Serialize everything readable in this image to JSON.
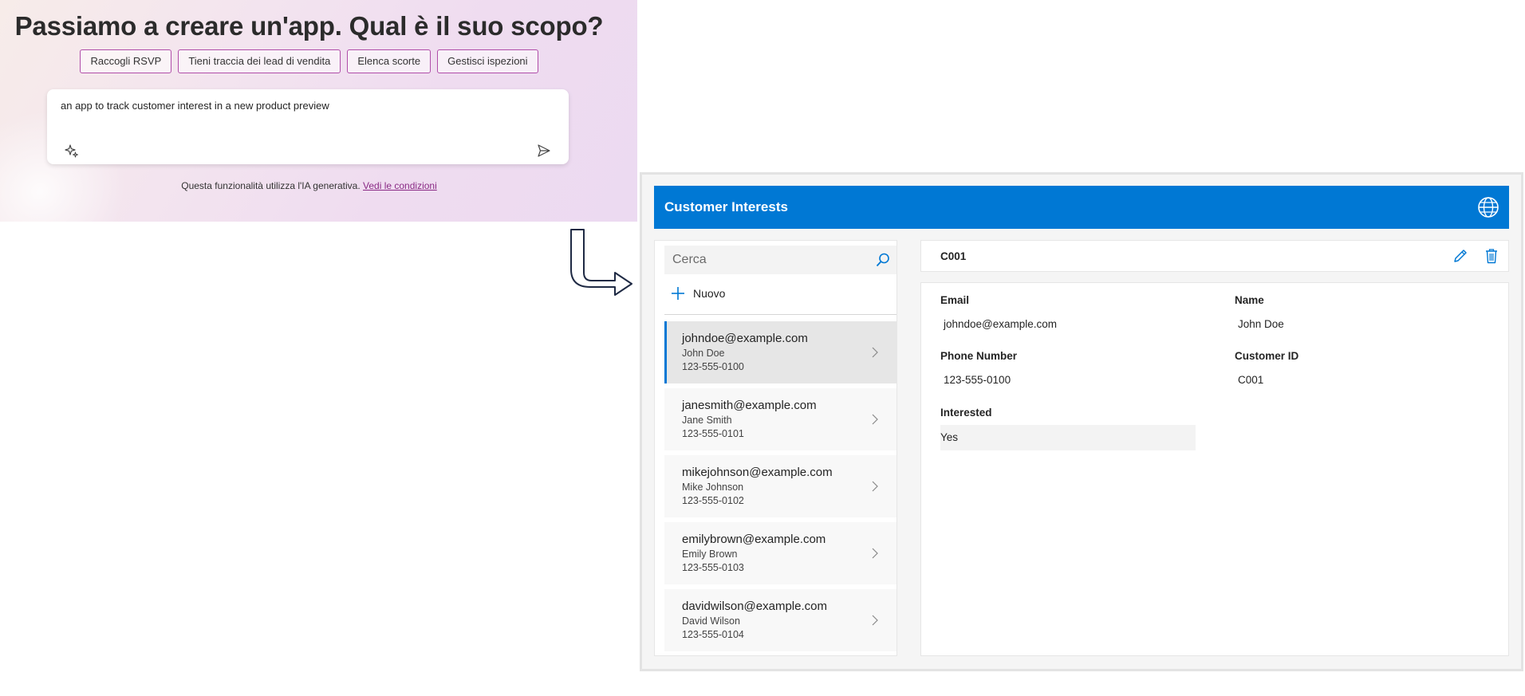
{
  "prompt": {
    "title": "Passiamo a creare un'app. Qual è il suo scopo?",
    "chips": [
      "Raccogli RSVP",
      "Tieni traccia dei lead di vendita",
      "Elenca scorte",
      "Gestisci ispezioni"
    ],
    "input_value": "an app to track customer interest in a new product preview",
    "disclaimer": "Questa funzionalità utilizza l'IA generativa.",
    "terms_link": "Vedi le condizioni"
  },
  "app": {
    "title": "Customer Interests",
    "search_placeholder": "Cerca",
    "new_label": "Nuovo",
    "customers": [
      {
        "email": "johndoe@example.com",
        "name": "John Doe",
        "phone": "123-555-0100"
      },
      {
        "email": "janesmith@example.com",
        "name": "Jane Smith",
        "phone": "123-555-0101"
      },
      {
        "email": "mikejohnson@example.com",
        "name": "Mike Johnson",
        "phone": "123-555-0102"
      },
      {
        "email": "emilybrown@example.com",
        "name": "Emily Brown",
        "phone": "123-555-0103"
      },
      {
        "email": "davidwilson@example.com",
        "name": "David Wilson",
        "phone": "123-555-0104"
      }
    ],
    "selected": {
      "id": "C001",
      "email_label": "Email",
      "email": "johndoe@example.com",
      "name_label": "Name",
      "name": "John Doe",
      "phone_label": "Phone Number",
      "phone": "123-555-0100",
      "customer_id_label": "Customer ID",
      "customer_id": "C001",
      "interested_label": "Interested",
      "interested": "Yes"
    }
  },
  "colors": {
    "accent": "#0078d4",
    "chip_border": "#b04da9",
    "link": "#8a2a85"
  },
  "icons": [
    "sparkle-icon",
    "send-icon",
    "globe-icon",
    "search-icon",
    "plus-icon",
    "chevron-right-icon",
    "edit-icon",
    "delete-icon",
    "arrow-icon"
  ]
}
